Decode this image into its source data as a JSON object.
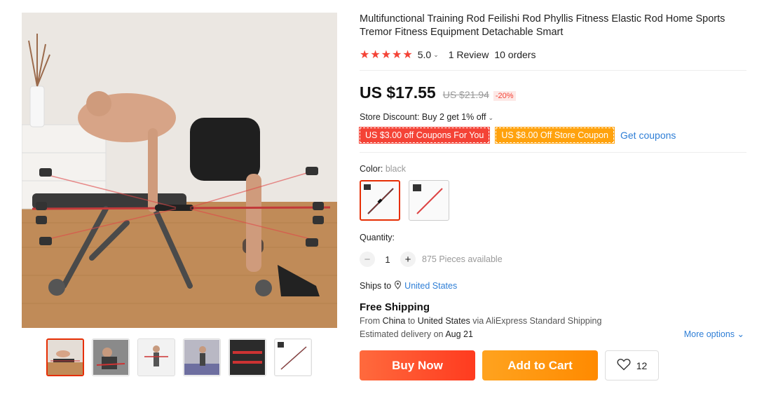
{
  "product": {
    "title": "Multifunctional Training Rod Feilishi Rod Phyllis Fitness Elastic Rod Home Sports Tremor Fitness Equipment Detachable Smart",
    "rating_stars": "★★★★★",
    "rating_score": "5.0",
    "reviews": "1 Review",
    "orders": "10 orders"
  },
  "price": {
    "current": "US $17.55",
    "original": "US $21.94",
    "discount": "-20%"
  },
  "store_discount": "Store Discount: Buy 2 get 1% off",
  "coupons": {
    "red": "US $3.00 off Coupons For You",
    "orange": "US $8.00 Off Store Coupon",
    "link": "Get coupons"
  },
  "color": {
    "label": "Color:",
    "value": "black"
  },
  "quantity": {
    "label": "Quantity:",
    "value": "1",
    "minus": "−",
    "plus": "+",
    "available": "875 Pieces available"
  },
  "shipping": {
    "ships_to_label": "Ships to",
    "country": "United States",
    "free_title": "Free Shipping",
    "from_label": "From",
    "from": "China",
    "to_label": "to",
    "to": "United States",
    "via": "via AliExpress Standard Shipping",
    "est_label": "Estimated delivery on",
    "est_date": "Aug 21",
    "more_options": "More options"
  },
  "actions": {
    "buy_now": "Buy Now",
    "add_to_cart": "Add to Cart",
    "wishlist_count": "12"
  },
  "colors": {
    "accent_red": "#e62e04",
    "star_red": "#f44336",
    "coupon_orange": "#ffa20d",
    "link_blue": "#2e7ed6"
  },
  "icons": [
    "star-icon",
    "chevron-down-icon",
    "location-pin-icon",
    "heart-icon",
    "minus-icon",
    "plus-icon"
  ]
}
